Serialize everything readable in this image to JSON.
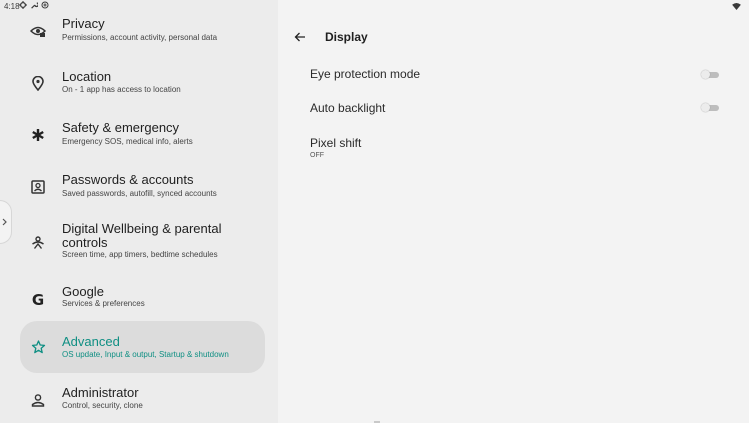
{
  "status_bar": {
    "time": "4:18"
  },
  "menu": [
    {
      "id": "privacy",
      "icon": "privacy-icon",
      "title": "Privacy",
      "subtitle": "Permissions, account activity, personal data"
    },
    {
      "id": "location",
      "icon": "location-pin-icon",
      "title": "Location",
      "subtitle": "On - 1 app has access to location"
    },
    {
      "id": "safety",
      "icon": "asterisk-icon",
      "title": "Safety & emergency",
      "subtitle": "Emergency SOS, medical info, alerts"
    },
    {
      "id": "passwords",
      "icon": "account-box-icon",
      "title": "Passwords & accounts",
      "subtitle": "Saved passwords, autofill, synced accounts"
    },
    {
      "id": "wellbeing",
      "icon": "wellbeing-icon",
      "title_line1": "Digital Wellbeing & parental",
      "title_line2": "controls",
      "subtitle": "Screen time, app timers, bedtime schedules"
    },
    {
      "id": "google",
      "icon": "google-g-icon",
      "title": "Google",
      "subtitle": "Services & preferences"
    },
    {
      "id": "advanced",
      "icon": "star-outline-icon",
      "title": "Advanced",
      "subtitle": "OS update, Input & output, Startup & shutdown",
      "selected": true
    },
    {
      "id": "administrator",
      "icon": "person-icon",
      "title": "Administrator",
      "subtitle": "Control, security, clone"
    }
  ],
  "detail": {
    "title": "Display",
    "settings": [
      {
        "label": "Eye protection mode",
        "toggle": "off"
      },
      {
        "label": "Auto backlight",
        "toggle": "off"
      },
      {
        "label": "Pixel shift",
        "value": "OFF"
      }
    ]
  },
  "colors": {
    "accent": "#0f8f83",
    "selected_bg": "#dcdcdc",
    "left_bg": "#ececec",
    "right_bg": "#f3f3f3"
  }
}
